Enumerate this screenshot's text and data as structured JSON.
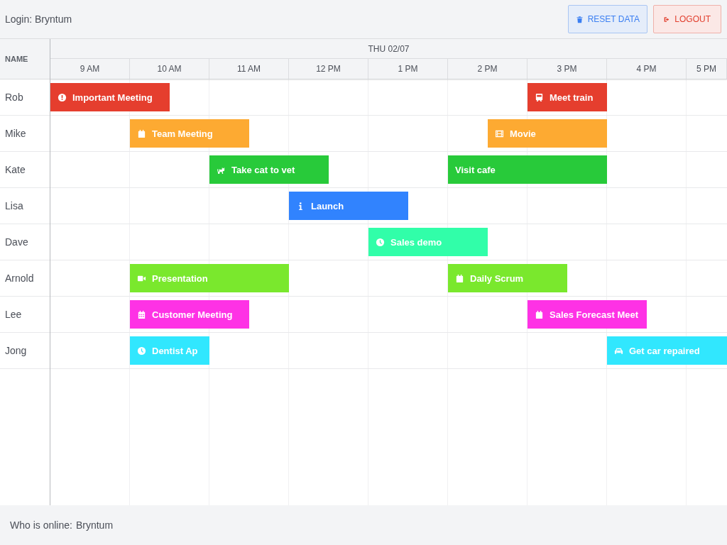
{
  "top_bar": {
    "login": "Login: Bryntum",
    "buttons": [
      {
        "kind": "reset",
        "label": "RESET DATA"
      },
      {
        "kind": "logout",
        "label": "LOGOUT"
      }
    ]
  },
  "scheduler": {
    "name_column": "NAME",
    "day": "THU 02/07",
    "hours": [
      "9 AM",
      "10 AM",
      "11 AM",
      "12 PM",
      "1 PM",
      "2 PM",
      "3 PM",
      "4 PM",
      "5 PM"
    ],
    "rows": [
      {
        "name": "Rob",
        "events": [
          {
            "title": "Important Meeting",
            "kind": "alert",
            "color": "#e53e2e"
          },
          {
            "title": "Meet train",
            "kind": "train",
            "color": "#e53e2e"
          }
        ]
      },
      {
        "name": "Mike",
        "events": [
          {
            "title": "Team Meeting",
            "kind": "calendar",
            "color": "#fdaa32"
          },
          {
            "title": "Movie",
            "kind": "film",
            "color": "#fdaa32"
          }
        ]
      },
      {
        "name": "Kate",
        "events": [
          {
            "title": "Take cat to vet",
            "kind": "cat",
            "color": "#28ca3a"
          },
          {
            "title": "Visit cafe",
            "kind": "plain",
            "color": "#28ca3a"
          }
        ]
      },
      {
        "name": "Lisa",
        "events": [
          {
            "title": "Launch",
            "kind": "info",
            "color": "#3183fe"
          }
        ]
      },
      {
        "name": "Dave",
        "events": [
          {
            "title": "Sales demo",
            "kind": "clock",
            "color": "#31fea9"
          }
        ]
      },
      {
        "name": "Arnold",
        "events": [
          {
            "title": "Presentation",
            "kind": "video",
            "color": "#7ae82d"
          },
          {
            "title": "Daily Scrum",
            "kind": "calendar",
            "color": "#7ae82d"
          }
        ]
      },
      {
        "name": "Lee",
        "events": [
          {
            "title": "Customer Meeting",
            "kind": "calendar-grid",
            "color": "#fe32e5"
          },
          {
            "title": "Sales Forecast Meet",
            "kind": "calendar",
            "color": "#fe32e5"
          }
        ]
      },
      {
        "name": "Jong",
        "events": [
          {
            "title": "Dentist Ap",
            "kind": "clock",
            "color": "#31e7fe"
          },
          {
            "title": "Get car repaired",
            "kind": "car",
            "color": "#31e7fe"
          }
        ]
      }
    ]
  },
  "footer": {
    "label": "Who is online:",
    "user": "Bryntum"
  }
}
